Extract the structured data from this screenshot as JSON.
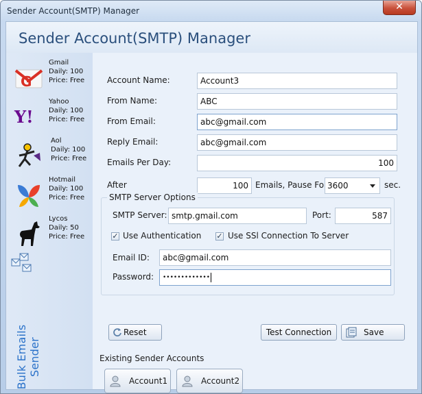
{
  "window": {
    "title": "Sender Account(SMTP) Manager",
    "close_symbol": "✕"
  },
  "header": {
    "title": "Sender Account(SMTP) Manager"
  },
  "sidebar": {
    "providers": [
      {
        "name": "Gmail",
        "daily": "Daily: 100",
        "price": "Price: Free",
        "icon": "gmail-icon"
      },
      {
        "name": "Yahoo",
        "daily": "Daily: 100",
        "price": "Price: Free",
        "icon": "yahoo-icon"
      },
      {
        "name": "Aol",
        "daily": "Daily: 100",
        "price": "Price: Free",
        "icon": "aol-icon"
      },
      {
        "name": "Hotmail",
        "daily": "Daily: 100",
        "price": "Price: Free",
        "icon": "hotmail-icon"
      },
      {
        "name": "Lycos",
        "daily": "Daily: 50",
        "price": "Price: Free",
        "icon": "lycos-icon"
      }
    ],
    "bulk_label": "Bulk Emails Sender"
  },
  "form": {
    "account_name_label": "Account Name:",
    "account_name_value": "Account3",
    "from_name_label": "From Name:",
    "from_name_value": "ABC",
    "from_email_label": "From Email:",
    "from_email_value": "abc@gmail.com",
    "reply_email_label": "Reply Email:",
    "reply_email_value": "abc@gmail.com",
    "emails_per_day_label": "Emails Per Day:",
    "emails_per_day_value": "100",
    "after_label": "After",
    "after_value": "100",
    "pause_label": "Emails, Pause For",
    "pause_value": "3600",
    "sec_label": "sec."
  },
  "smtp": {
    "group_title": "SMTP Server Options",
    "server_label": "SMTP Server:",
    "server_value": "smtp.gmail.com",
    "port_label": "Port:",
    "port_value": "587",
    "use_auth_label": "Use Authentication",
    "use_auth_checked": true,
    "use_ssl_label": "Use SSl Connection To Server",
    "use_ssl_checked": true,
    "email_id_label": "Email ID:",
    "email_id_value": "abc@gmail.com",
    "password_label": "Password:",
    "password_value": "•••••••••••••"
  },
  "buttons": {
    "reset": "Reset",
    "test_connection": "Test Connection",
    "save": "Save"
  },
  "existing": {
    "title": "Existing Sender Accounts",
    "accounts": [
      "Account1",
      "Account2"
    ]
  }
}
